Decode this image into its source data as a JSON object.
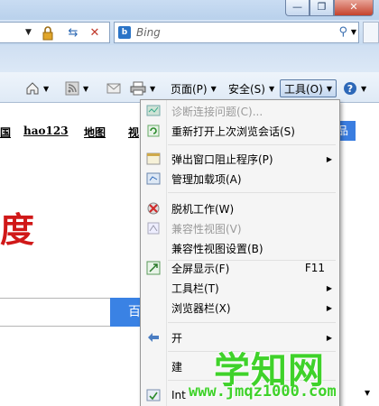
{
  "window": {
    "minimize": "—",
    "maximize": "❐",
    "close": "✕"
  },
  "address": {
    "lock_icon": "lock-icon",
    "refresh": "⇆",
    "stop": "✕"
  },
  "search": {
    "placeholder": "Bing",
    "logo": "b"
  },
  "toolbar": {
    "page": "页面(P)",
    "safety": "安全(S)",
    "tools": "工具(O)",
    "help": "?"
  },
  "content": {
    "nav": [
      "国",
      "hao123",
      "地图",
      "视"
    ],
    "more_button": "品",
    "red_text": "度",
    "search_button": "百"
  },
  "menu": {
    "items": [
      {
        "label": "诊断连接问题(C)...",
        "disabled": true
      },
      {
        "label": "重新打开上次浏览会话(S)",
        "disabled": false
      },
      {
        "label": "弹出窗口阻止程序(P)",
        "arrow": true
      },
      {
        "label": "管理加载项(A)"
      },
      {
        "label": "脱机工作(W)"
      },
      {
        "label": "兼容性视图(V)",
        "disabled": true
      },
      {
        "label": "兼容性视图设置(B)"
      },
      {
        "label": "全屏显示(F)",
        "shortcut": "F11"
      },
      {
        "label": "工具栏(T)",
        "arrow": true
      },
      {
        "label": "浏览器栏(X)",
        "arrow": true
      },
      {
        "label": "开"
      },
      {
        "label": "建"
      },
      {
        "label": "Int"
      }
    ]
  },
  "watermark": {
    "main": "学知网",
    "url": "www.jmqz1000.com"
  },
  "colors": {
    "accent": "#3a7de0",
    "red": "#d01818",
    "watermark": "#3fd22a"
  }
}
